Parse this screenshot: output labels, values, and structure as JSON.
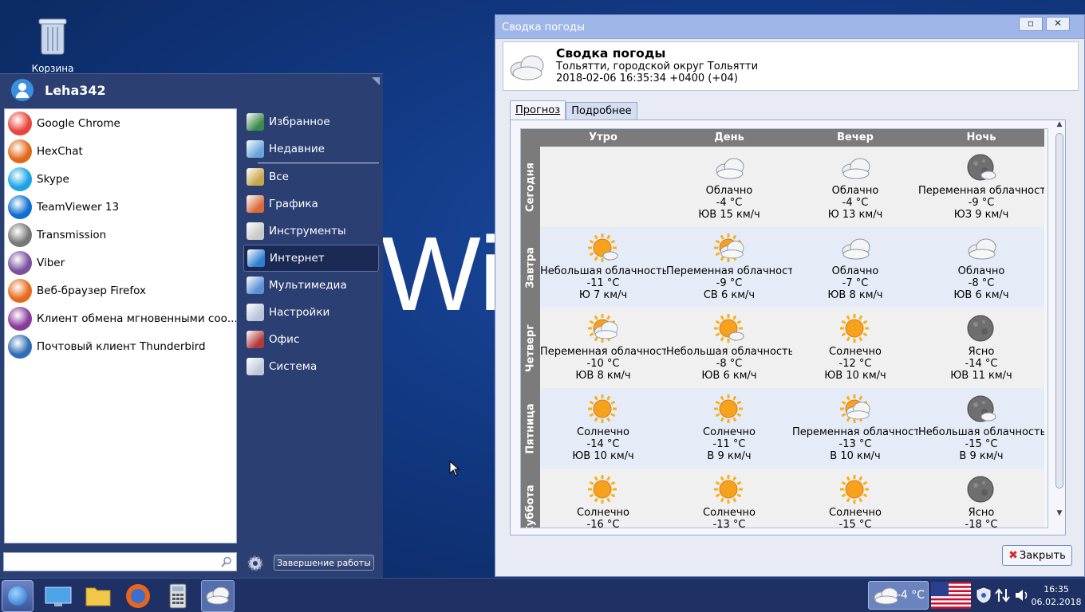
{
  "desktop": {
    "trash_label": "Корзина",
    "wallpaper_text": "Wi"
  },
  "start_menu": {
    "username": "Leha342",
    "favorites": [
      {
        "label": "Google Chrome",
        "icon": "chrome-icon",
        "color": "#e8453c"
      },
      {
        "label": "HexChat",
        "icon": "hexchat-icon",
        "color": "#e06a1b"
      },
      {
        "label": "Skype",
        "icon": "skype-icon",
        "color": "#1aa3e8"
      },
      {
        "label": "TeamViewer 13",
        "icon": "teamviewer-icon",
        "color": "#0e6ed2"
      },
      {
        "label": "Transmission",
        "icon": "transmission-icon",
        "color": "#777777"
      },
      {
        "label": "Viber",
        "icon": "viber-icon",
        "color": "#7b519d"
      },
      {
        "label": "Веб-браузер Firefox",
        "icon": "firefox-icon",
        "color": "#e86a1c"
      },
      {
        "label": "Клиент обмена мгновенными соо...",
        "icon": "pidgin-icon",
        "color": "#8a3a9b"
      },
      {
        "label": "Почтовый клиент Thunderbird",
        "icon": "thunderbird-icon",
        "color": "#2f6db5"
      }
    ],
    "categories": [
      {
        "label": "Избранное",
        "icon": "favorites-icon",
        "color": "#3b8a4a"
      },
      {
        "label": "Недавние",
        "icon": "recent-icon",
        "color": "#6aa3d8"
      },
      {
        "label": "Все",
        "icon": "all-icon",
        "color": "#c9a54a"
      },
      {
        "label": "Графика",
        "icon": "graphics-icon",
        "color": "#d96a3a"
      },
      {
        "label": "Инструменты",
        "icon": "tools-icon",
        "color": "#c9c9c9"
      },
      {
        "label": "Интернет",
        "icon": "internet-icon",
        "color": "#2e7fd1"
      },
      {
        "label": "Мультимедиа",
        "icon": "multimedia-icon",
        "color": "#5b8fd6"
      },
      {
        "label": "Настройки",
        "icon": "settings-icon",
        "color": "#b9c4d9"
      },
      {
        "label": "Офис",
        "icon": "office-icon",
        "color": "#b23a3a"
      },
      {
        "label": "Система",
        "icon": "system-icon",
        "color": "#c0c8da"
      }
    ],
    "active_category": "Интернет",
    "search": {
      "value": "",
      "placeholder": ""
    },
    "shutdown_label": "Завершение работы"
  },
  "weather_window": {
    "title": "Сводка погоды",
    "header": {
      "title": "Сводка погоды",
      "location": "Тольятти, городской округ Тольятти",
      "datetime": "2018-02-06 16:35:34 +0400 (+04)"
    },
    "tabs": [
      {
        "label": "Прогноз",
        "active": true
      },
      {
        "label": "Подробнее",
        "active": false
      }
    ],
    "columns": [
      "Утро",
      "День",
      "Вечер",
      "Ночь"
    ],
    "days": [
      {
        "label": "Сегодня",
        "cells": [
          null,
          {
            "cond": "Облачно",
            "temp": "-4 °C",
            "wind": "ЮВ 15 км/ч",
            "icon": "cloudy"
          },
          {
            "cond": "Облачно",
            "temp": "-4 °C",
            "wind": "Ю 13 км/ч",
            "icon": "cloudy"
          },
          {
            "cond": "Переменная облачность",
            "temp": "-9 °C",
            "wind": "ЮЗ 9 км/ч",
            "icon": "moon-cloud"
          }
        ]
      },
      {
        "label": "Завтра",
        "cells": [
          {
            "cond": "Небольшая облачность",
            "temp": "-11 °C",
            "wind": "Ю 7 км/ч",
            "icon": "sun-small-cloud"
          },
          {
            "cond": "Переменная облачность",
            "temp": "-9 °C",
            "wind": "СВ 6 км/ч",
            "icon": "sun-cloud"
          },
          {
            "cond": "Облачно",
            "temp": "-7 °C",
            "wind": "ЮВ 8 км/ч",
            "icon": "cloudy"
          },
          {
            "cond": "Облачно",
            "temp": "-8 °C",
            "wind": "ЮВ 6 км/ч",
            "icon": "cloudy"
          }
        ]
      },
      {
        "label": "Четверг",
        "cells": [
          {
            "cond": "Переменная облачность",
            "temp": "-10 °C",
            "wind": "ЮВ 8 км/ч",
            "icon": "sun-cloud"
          },
          {
            "cond": "Небольшая облачность",
            "temp": "-8 °C",
            "wind": "ЮВ 6 км/ч",
            "icon": "sun-small-cloud"
          },
          {
            "cond": "Солнечно",
            "temp": "-12 °C",
            "wind": "ЮВ 10 км/ч",
            "icon": "sun"
          },
          {
            "cond": "Ясно",
            "temp": "-14 °C",
            "wind": "ЮВ 11 км/ч",
            "icon": "moon"
          }
        ]
      },
      {
        "label": "Пятница",
        "cells": [
          {
            "cond": "Солнечно",
            "temp": "-14 °C",
            "wind": "ЮВ 10 км/ч",
            "icon": "sun"
          },
          {
            "cond": "Солнечно",
            "temp": "-11 °C",
            "wind": "В 9 км/ч",
            "icon": "sun"
          },
          {
            "cond": "Переменная облачность",
            "temp": "-13 °C",
            "wind": "В 10 км/ч",
            "icon": "sun-cloud"
          },
          {
            "cond": "Небольшая облачность",
            "temp": "-15 °C",
            "wind": "В 9 км/ч",
            "icon": "moon-cloud"
          }
        ]
      },
      {
        "label": "Суббота",
        "cells": [
          {
            "cond": "Солнечно",
            "temp": "-16 °C",
            "wind": "",
            "icon": "sun"
          },
          {
            "cond": "Солнечно",
            "temp": "-13 °C",
            "wind": "",
            "icon": "sun"
          },
          {
            "cond": "Солнечно",
            "temp": "-15 °C",
            "wind": "",
            "icon": "sun"
          },
          {
            "cond": "Ясно",
            "temp": "-18 °C",
            "wind": "",
            "icon": "moon"
          }
        ]
      }
    ],
    "close_label": "Закрыть"
  },
  "taskbar": {
    "apps": [
      "start-button",
      "show-desktop-icon",
      "file-manager-icon",
      "firefox-icon",
      "calculator-icon",
      "weather-icon"
    ],
    "tray_temp": "-4 °C",
    "clock_time": "16:35",
    "clock_date": "06.02.2018"
  },
  "colors": {
    "desktop_bg": "#123a86",
    "menu_bg": "#2b3f72",
    "title_bar": "#9fb6e8",
    "grid_header": "#7b7b7b"
  }
}
